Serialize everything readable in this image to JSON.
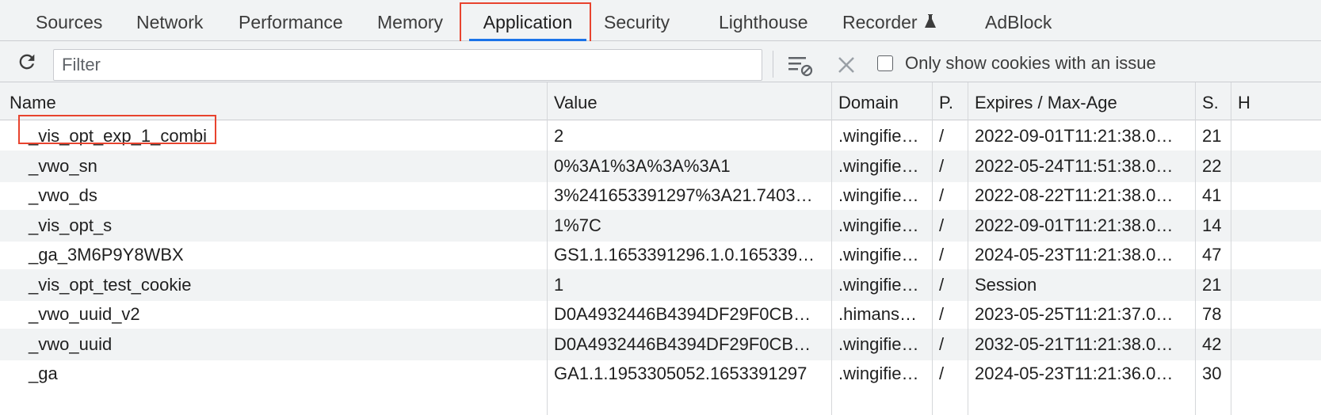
{
  "tabs": [
    {
      "label": "Sources"
    },
    {
      "label": "Network"
    },
    {
      "label": "Performance"
    },
    {
      "label": "Memory"
    },
    {
      "label": "Application"
    },
    {
      "label": "Security"
    },
    {
      "label": "Lighthouse"
    },
    {
      "label": "Recorder"
    },
    {
      "label": "AdBlock"
    }
  ],
  "active_tab": "Application",
  "toolbar": {
    "filter_placeholder": "Filter",
    "only_issues_label": "Only show cookies with an issue"
  },
  "table": {
    "columns": [
      "Name",
      "Value",
      "Domain",
      "P.",
      "Expires / Max-Age",
      "S.",
      "H"
    ],
    "rows": [
      [
        "_vis_opt_exp_1_combi",
        "2",
        ".wingifie…",
        "/",
        "2022-09-01T11:21:38.0…",
        "21"
      ],
      [
        "_vwo_sn",
        "0%3A1%3A%3A%3A1",
        ".wingifie…",
        "/",
        "2022-05-24T11:51:38.0…",
        "22"
      ],
      [
        "_vwo_ds",
        "3%241653391297%3A21.7403…",
        ".wingifie…",
        "/",
        "2022-08-22T11:21:38.0…",
        "41"
      ],
      [
        "_vis_opt_s",
        "1%7C",
        ".wingifie…",
        "/",
        "2022-09-01T11:21:38.0…",
        "14"
      ],
      [
        "_ga_3M6P9Y8WBX",
        "GS1.1.1653391296.1.0.165339…",
        ".wingifie…",
        "/",
        "2024-05-23T11:21:38.0…",
        "47"
      ],
      [
        "_vis_opt_test_cookie",
        "1",
        ".wingifie…",
        "/",
        "Session",
        "21"
      ],
      [
        "_vwo_uuid_v2",
        "D0A4932446B4394DF29F0CB…",
        ".himans…",
        "/",
        "2023-05-25T11:21:37.0…",
        "78"
      ],
      [
        "_vwo_uuid",
        "D0A4932446B4394DF29F0CB…",
        ".wingifie…",
        "/",
        "2032-05-21T11:21:38.0…",
        "42"
      ],
      [
        "_ga",
        "GA1.1.1953305052.1653391297",
        ".wingifie…",
        "/",
        "2024-05-23T11:21:36.0…",
        "30"
      ]
    ]
  },
  "colors": {
    "highlight": "#e8432e",
    "active_underline": "#1a73e8",
    "toolbar_bg": "#f1f3f4"
  },
  "icons": [
    "refresh-icon",
    "clear-filtered-icon",
    "delete-icon",
    "flask-icon"
  ]
}
